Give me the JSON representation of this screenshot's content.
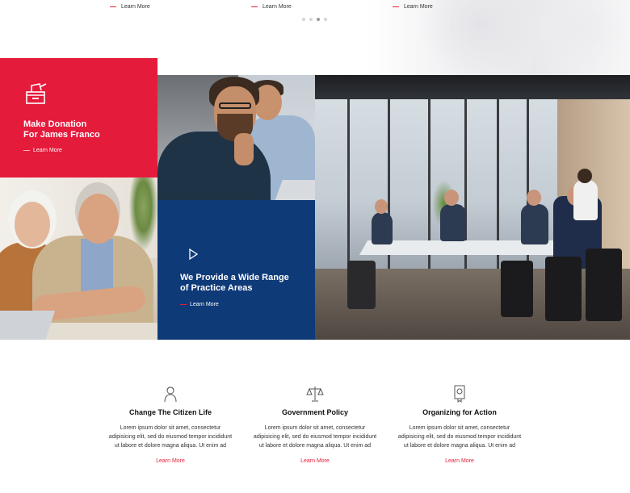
{
  "top_links": [
    {
      "label": "Learn More"
    },
    {
      "label": "Learn More"
    },
    {
      "label": "Learn More"
    }
  ],
  "slider": {
    "dots": 4,
    "active_index": 2
  },
  "donation": {
    "title_line1": "Make Donation",
    "title_line2": "For James Franco",
    "link": "Learn More",
    "icon": "donation-box-icon",
    "color": "#e51b3c"
  },
  "practice": {
    "title_line1": "We Provide a Wide Range",
    "title_line2": "of Practice Areas",
    "link": "Learn More",
    "icon": "play-icon",
    "color": "#0f3a78"
  },
  "features": [
    {
      "icon": "citizen-icon",
      "title": "Change The Citizen Life",
      "desc_line1": "Lorem ipsum dolor sit amet, consectetur",
      "desc_line2": "adipisicing elit, sed do eiusmod tempor incididunt",
      "desc_line3": "ut labore et dolore magna aliqua. Ut enim ad",
      "link": "Learn More"
    },
    {
      "icon": "scales-icon",
      "title": "Government Policy",
      "desc_line1": "Lorem ipsum dolor sit amet, consectetur",
      "desc_line2": "adipisicing elit, sed do eiusmod tempor incididunt",
      "desc_line3": "ut labore et dolore magna aliqua. Ut enim ad",
      "link": "Learn More"
    },
    {
      "icon": "award-icon",
      "title": "Organizing for Action",
      "desc_line1": "Lorem ipsum dolor sit amet, consectetur",
      "desc_line2": "adipisicing elit, sed do eiusmod tempor incididunt",
      "desc_line3": "ut labore et dolore magna aliqua. Ut enim ad",
      "link": "Learn More"
    }
  ],
  "accent_color": "#e8203a"
}
